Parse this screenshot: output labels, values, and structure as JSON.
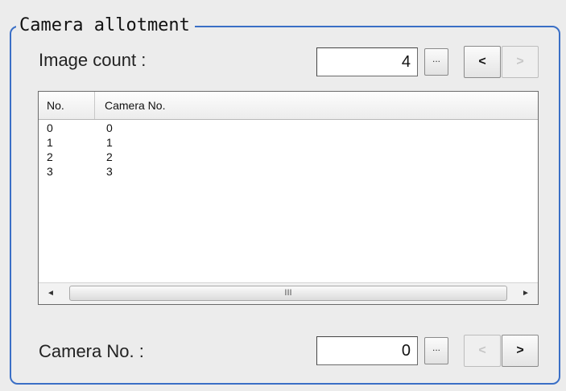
{
  "group": {
    "title": "Camera allotment"
  },
  "image_count": {
    "label": "Image count :",
    "value": "4",
    "ellipsis": "...",
    "prev": "<",
    "next": ">"
  },
  "list": {
    "columns": [
      "No.",
      "Camera No."
    ],
    "rows": [
      [
        "0",
        "0"
      ],
      [
        "1",
        "1"
      ],
      [
        "2",
        "2"
      ],
      [
        "3",
        "3"
      ]
    ],
    "scroll_left": "◄",
    "scroll_right": "►",
    "thumb_grip": "III"
  },
  "camera_no": {
    "label": "Camera No. :",
    "value": "0",
    "ellipsis": "...",
    "prev": "<",
    "next": ">"
  }
}
